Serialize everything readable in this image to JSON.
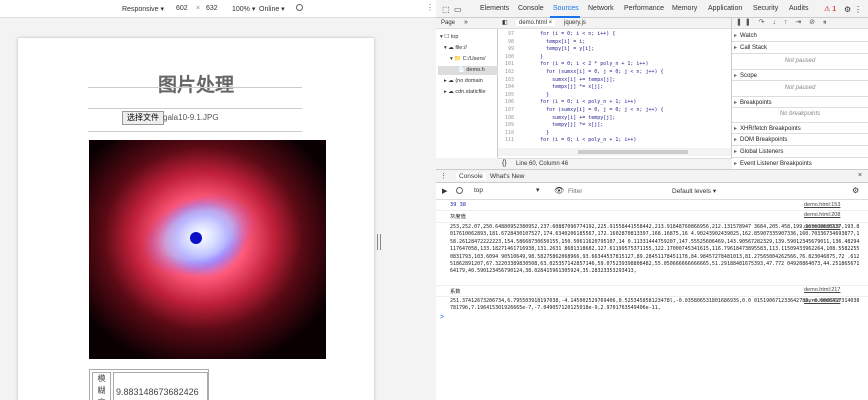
{
  "device_toolbar": {
    "device": "Responsive ▾",
    "width": "602",
    "x": "×",
    "height": "632",
    "zoom": "100% ▾",
    "network": "Online ▾"
  },
  "page": {
    "title": "图片处理",
    "file_button": "选择文件",
    "file_name": "gala10-9.1.JPG",
    "table_label": "模糊度值",
    "table_label_chars": [
      "模",
      "糊",
      "度",
      "值"
    ],
    "table_value": "9.883148673682426"
  },
  "devtools": {
    "tabs": [
      "Elements",
      "Console",
      "Sources",
      "Network",
      "Performance",
      "Memory",
      "Application",
      "Security",
      "Audits"
    ],
    "active_tab": "Sources",
    "errors": "⚠ 1",
    "nav": {
      "page_tab": "Page",
      "more": "»",
      "tree": [
        "▾ ☐ top",
        "▾ ☁ file://",
        "▾ 📁 C:/Users/",
        "📄 demo.h",
        "▸ ☁ (no domain",
        "▸ ☁ cdn.staticfile"
      ]
    },
    "editor": {
      "file1": "demo.html ×",
      "file2": "jquery.js",
      "lines": [
        {
          "n": "97",
          "c": "        for (i = 0; i < n; i++) {"
        },
        {
          "n": "98",
          "c": "          tempx[i] = i;"
        },
        {
          "n": "99",
          "c": "          tempy[i] = y[i];"
        },
        {
          "n": "100",
          "c": "        }"
        },
        {
          "n": "101",
          "c": "        for (i = 0; i < 2 * poly_n + 1; i++)"
        },
        {
          "n": "102",
          "c": "          for (sumxx[i] = 0, j = 0; j < n; j++) {"
        },
        {
          "n": "103",
          "c": "            sumxx[i] += tempx[j];"
        },
        {
          "n": "104",
          "c": "            tempx[j] *= x[j];"
        },
        {
          "n": "105",
          "c": "          }"
        },
        {
          "n": "106",
          "c": "        for (i = 0; i < poly_n + 1; i++)"
        },
        {
          "n": "107",
          "c": "          for (sumxy[i] = 0, j = 0; j < n; j++) {"
        },
        {
          "n": "108",
          "c": "            sumxy[i] += tempy[j];"
        },
        {
          "n": "109",
          "c": "            tempy[j] *= x[j];"
        },
        {
          "n": "110",
          "c": "          }"
        },
        {
          "n": "111",
          "c": "        for (i = 0; i < poly_n + 1; i++)"
        }
      ],
      "status": "Line 60, Column 46"
    },
    "debug": {
      "watch": "Watch",
      "callstack": "Call Stack",
      "np1": "Not paused",
      "scope": "Scope",
      "np2": "Not paused",
      "breakpoints": "Breakpoints",
      "nobp": "No breakpoints",
      "xhr": "XHR/fetch Breakpoints",
      "dom": "DOM Breakpoints",
      "global": "Global Listeners",
      "event": "Event Listener Breakpoints"
    },
    "console": {
      "tabs": [
        "Console",
        "What's New"
      ],
      "context": "top",
      "filter_placeholder": "Filter",
      "levels": "Default levels ▾",
      "entries": [
        {
          "text": "39 38",
          "src": "demo.html:153",
          "blue": true
        },
        {
          "text": "灰度值",
          "src": "demo.html:208",
          "blue": false
        },
        {
          "text": "253,252.07,250.64880952380952,237.60887096774192,225.91558441558442,213.91848760866956,212.131578947 3684,205.458,199.263698630137,193.8017610062893,181.6728430107527,174.6340206185567,172.1602870813397,168.16875,16 4.90243902439025,162.85907335907336,160.70336734693877,158.26128472222223,154.58668730650155,150.50611620795107,14 0.11331444759207,147.55525606469,143.90567282329,139.59012345679011,136.48294117647058,133.18271461716938,131.2631 8681318682,127.61199575371155,122.17000745341615,116.79618473895583,113.11509433962264,108.55822550831793,103.6094 90510649,98.58275862068966,93.66344537815127,89.28451178451178,84.98457278481013,81.27565004262566,76.823046875,72 .61251862891207,67.32203389830508,63.025357142857146,59.075239398808482,55.050666666666665,51.29188481675393,47.772 04920864073,44.25186567164179,40.590123456790124,38.028415961305924,35.28323353293413,",
          "src": "demo.html:209",
          "blue": false,
          "wrap": true
        },
        {
          "text": "系数",
          "src": "demo.html:217",
          "blue": false
        },
        {
          "text": "251.37412673206734,6.795503918197038,-4.145002529769406,0.525345858123478l,-0.03580653180168693S,0.0 015190671233642788,-0.000041731403878179б,7.196415301926665e-7,-7.049057120125018e-9,2.9701763549406e-11,",
          "src": "demo.html:218",
          "blue": false,
          "wrap": true
        }
      ],
      "prompt": ">"
    }
  }
}
